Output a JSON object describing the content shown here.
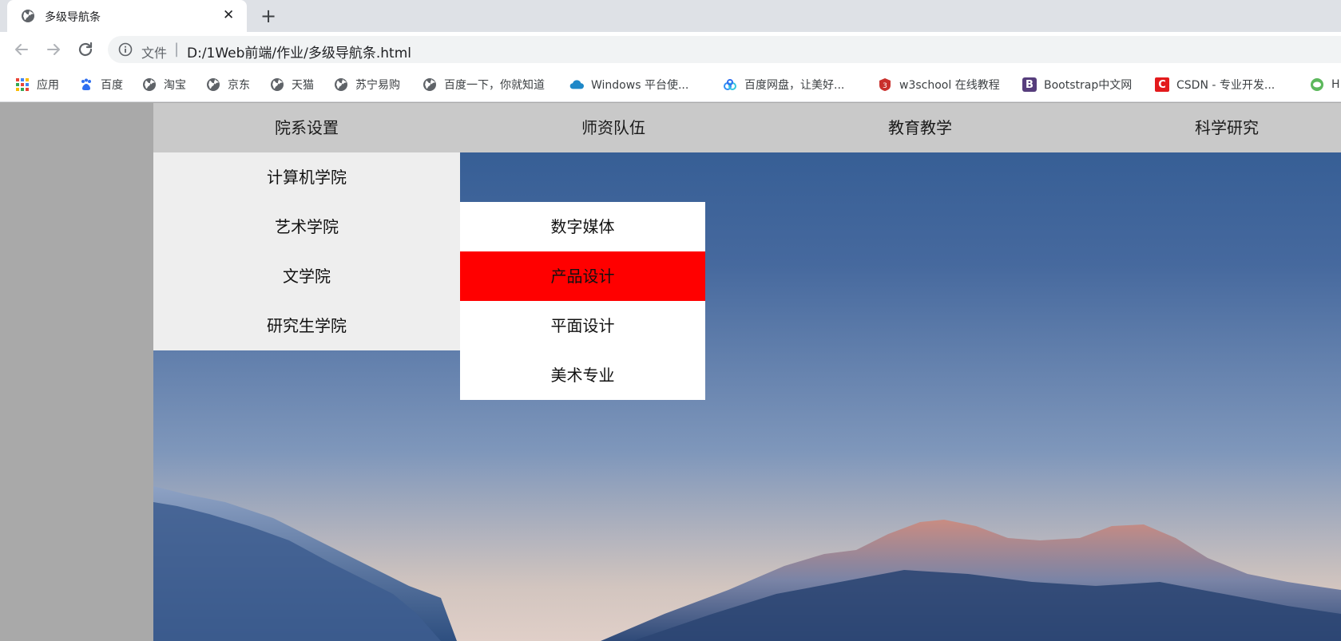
{
  "browser": {
    "tab_title": "多级导航条",
    "new_tab": "+",
    "close": "✕",
    "scheme_label": "文件",
    "separator": "|",
    "url": "D:/1Web前端/作业/多级导航条.html",
    "bookmarks": [
      {
        "label": "应用",
        "icon": "apps-grid-icon"
      },
      {
        "label": "百度",
        "icon": "baidu-paw-icon"
      },
      {
        "label": "淘宝",
        "icon": "globe-icon"
      },
      {
        "label": "京东",
        "icon": "globe-icon"
      },
      {
        "label": "天猫",
        "icon": "globe-icon"
      },
      {
        "label": "苏宁易购",
        "icon": "globe-icon"
      },
      {
        "label": "百度一下，你就知道",
        "icon": "globe-icon"
      },
      {
        "label": "Windows 平台使...",
        "icon": "cloud-icon"
      },
      {
        "label": "百度网盘，让美好...",
        "icon": "baidu-netdisk-icon"
      },
      {
        "label": "w3school 在线教程",
        "icon": "w3school-icon"
      },
      {
        "label": "Bootstrap中文网",
        "icon": "bootstrap-icon"
      },
      {
        "label": "CSDN - 专业开发...",
        "icon": "csdn-icon"
      },
      {
        "label": "H",
        "icon": "wechat-icon"
      }
    ]
  },
  "nav": {
    "items": [
      "院系设置",
      "师资队伍",
      "教育教学",
      "科学研究"
    ],
    "submenu": [
      "计算机学院",
      "艺术学院",
      "文学院",
      "研究生学院"
    ],
    "subsubmenu": [
      "数字媒体",
      "产品设计",
      "平面设计",
      "美术专业"
    ],
    "active_subsub": "产品设计",
    "colors": {
      "menubar": "#c9c9c9",
      "submenu": "#eeeeee",
      "subsubmenu": "#ffffff",
      "hover": "#ff0000",
      "side": "#a9a9a9"
    }
  },
  "icons": {
    "b_letter": "B",
    "csdn_letter": "C"
  }
}
